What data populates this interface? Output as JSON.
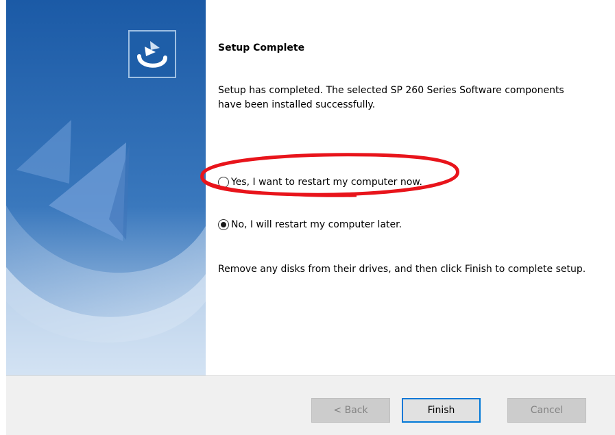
{
  "wizard": {
    "title": "Setup Complete",
    "description": "Setup has completed. The selected SP 260 Series Software components have been installed successfully.",
    "options": [
      {
        "label": "Yes, I want to restart my computer now.",
        "selected": false
      },
      {
        "label": "No, I will restart my computer later.",
        "selected": true
      }
    ],
    "instruction": "Remove any disks from their drives, and then click Finish to complete setup."
  },
  "buttons": {
    "back": "< Back",
    "finish": "Finish",
    "cancel": "Cancel"
  },
  "colors": {
    "panel_blue": "#1e5ea8",
    "annotation_red": "#e8141b",
    "focus_border": "#0078d7"
  },
  "icons": {
    "installer_logo": "installer-logo-icon"
  }
}
